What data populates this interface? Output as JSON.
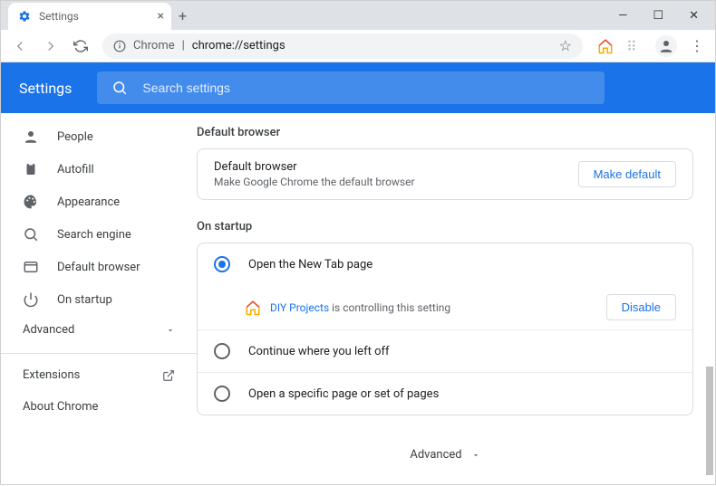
{
  "window": {
    "tab_title": "Settings",
    "new_tab": "+"
  },
  "address": {
    "origin_label": "Chrome",
    "url_path": "chrome://settings"
  },
  "header": {
    "title": "Settings",
    "search_placeholder": "Search settings"
  },
  "sidebar": {
    "items": [
      {
        "label": "People"
      },
      {
        "label": "Autofill"
      },
      {
        "label": "Appearance"
      },
      {
        "label": "Search engine"
      },
      {
        "label": "Default browser"
      },
      {
        "label": "On startup"
      }
    ],
    "advanced_label": "Advanced",
    "extensions_label": "Extensions",
    "about_label": "About Chrome"
  },
  "main": {
    "default_browser_section": "Default browser",
    "default_browser_title": "Default browser",
    "default_browser_sub": "Make Google Chrome the default browser",
    "make_default_btn": "Make default",
    "on_startup_section": "On startup",
    "opt_new_tab": "Open the New Tab page",
    "ext_name": "DIY Projects",
    "ext_controlling": " is controlling this setting",
    "disable_btn": "Disable",
    "opt_continue": "Continue where you left off",
    "opt_specific": "Open a specific page or set of pages",
    "adv_footer": "Advanced"
  }
}
